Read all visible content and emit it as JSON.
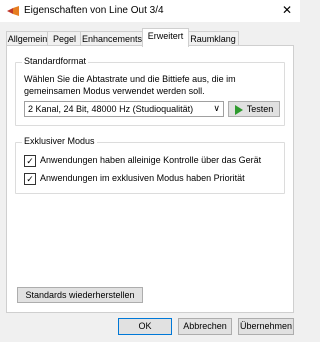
{
  "window": {
    "title": "Eigenschaften von Line Out 3/4",
    "icon": "speaker-icon",
    "close_label": "✕"
  },
  "tabs": [
    {
      "label": "Allgemein",
      "active": false
    },
    {
      "label": "Pegel",
      "active": false
    },
    {
      "label": "Enhancements",
      "active": false
    },
    {
      "label": "Erweitert",
      "active": true
    },
    {
      "label": "Raumklang",
      "active": false
    }
  ],
  "default_format": {
    "title": "Standardformat",
    "description": "Wählen Sie die Abtastrate und die Bittiefe aus, die im gemeinsamen Modus verwendet werden soll.",
    "selected": "2 Kanal, 24 Bit, 48000 Hz (Studioqualität)",
    "test_label": "Testen"
  },
  "exclusive_mode": {
    "title": "Exklusiver Modus",
    "options": [
      {
        "label": "Anwendungen haben alleinige Kontrolle über das Gerät",
        "checked": true
      },
      {
        "label": "Anwendungen im exklusiven Modus haben Priorität",
        "checked": true
      }
    ]
  },
  "restore_label": "Standards wiederherstellen",
  "footer": {
    "ok": "OK",
    "cancel": "Abbrechen",
    "apply": "Übernehmen"
  }
}
